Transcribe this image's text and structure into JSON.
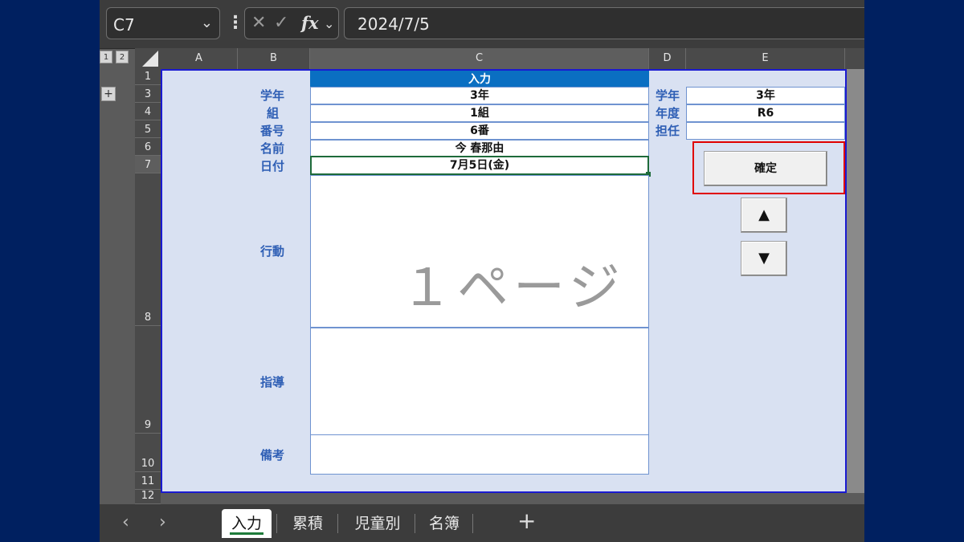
{
  "formula_bar": {
    "name_box": "C7",
    "cancel_glyph": "✕",
    "enter_glyph": "✓",
    "fx_label": "fx",
    "value": "2024/7/5"
  },
  "outline": {
    "level1": "1",
    "level2": "2",
    "expand": "+"
  },
  "columns": [
    "A",
    "B",
    "C",
    "D",
    "E"
  ],
  "rows": [
    "1",
    "3",
    "4",
    "5",
    "6",
    "7",
    "8",
    "9",
    "10",
    "11",
    "12"
  ],
  "form": {
    "header": "入力",
    "labels": {
      "grade": "学年",
      "class": "組",
      "number": "番号",
      "name": "名前",
      "date": "日付",
      "behavior": "行動",
      "guidance": "指導",
      "remarks": "備考"
    },
    "values": {
      "grade": "3年",
      "class": "1組",
      "number": "6番",
      "name": "今 春那由",
      "date": "7月5日(金)"
    },
    "page_watermark": "１ページ"
  },
  "side": {
    "labels": {
      "grade": "学年",
      "year": "年度",
      "teacher": "担任"
    },
    "values": {
      "grade": "3年",
      "year": "R6",
      "teacher": ""
    },
    "confirm_label": "確定",
    "up_label": "▲",
    "down_label": "▼"
  },
  "tabs": {
    "prev": "‹",
    "next": "›",
    "items": [
      "入力",
      "累積",
      "児童別",
      "名簿"
    ],
    "add": "+"
  },
  "colors": {
    "background": "#002060",
    "sheet_fill": "#d9e1f2",
    "header_fill": "#0a6fc2",
    "highlight": "#e00000",
    "label_text": "#2f5fb5"
  }
}
